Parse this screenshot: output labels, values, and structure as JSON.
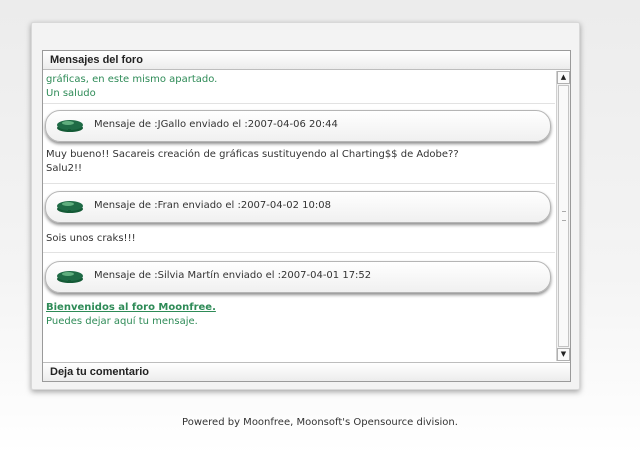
{
  "forum": {
    "title": "Mensajes del foro",
    "comment_label": "Deja tu comentario"
  },
  "intro": {
    "line1": "gráficas, en este mismo apartado.",
    "line2": "Un saludo"
  },
  "messages": [
    {
      "header": "Mensaje de :JGallo enviado el :2007-04-06 20:44",
      "lines": [
        "Muy bueno!! Sacareis creación de gráficas sustituyendo al Charting$$ de Adobe??",
        "Salu2!!"
      ]
    },
    {
      "header": "Mensaje de :Fran enviado el :2007-04-02 10:08",
      "lines": [
        "Sois unos craks!!!"
      ]
    },
    {
      "header": "Mensaje de :Silvia Martín enviado el :2007-04-01 17:52",
      "lines": []
    }
  ],
  "welcome": {
    "link": "Bienvenidos al foro Moonfree.",
    "text": "Puedes dejar aquí tu mensaje."
  },
  "footer": "Powered by Moonfree, Moonsoft's Opensource division.",
  "colors": {
    "text_green": "#2e8b57",
    "avatar_green": "#1f6b46"
  },
  "icons": {
    "avatar": "green-disc-icon",
    "scroll_up": "triangle-up-icon",
    "scroll_down": "triangle-down-icon"
  }
}
